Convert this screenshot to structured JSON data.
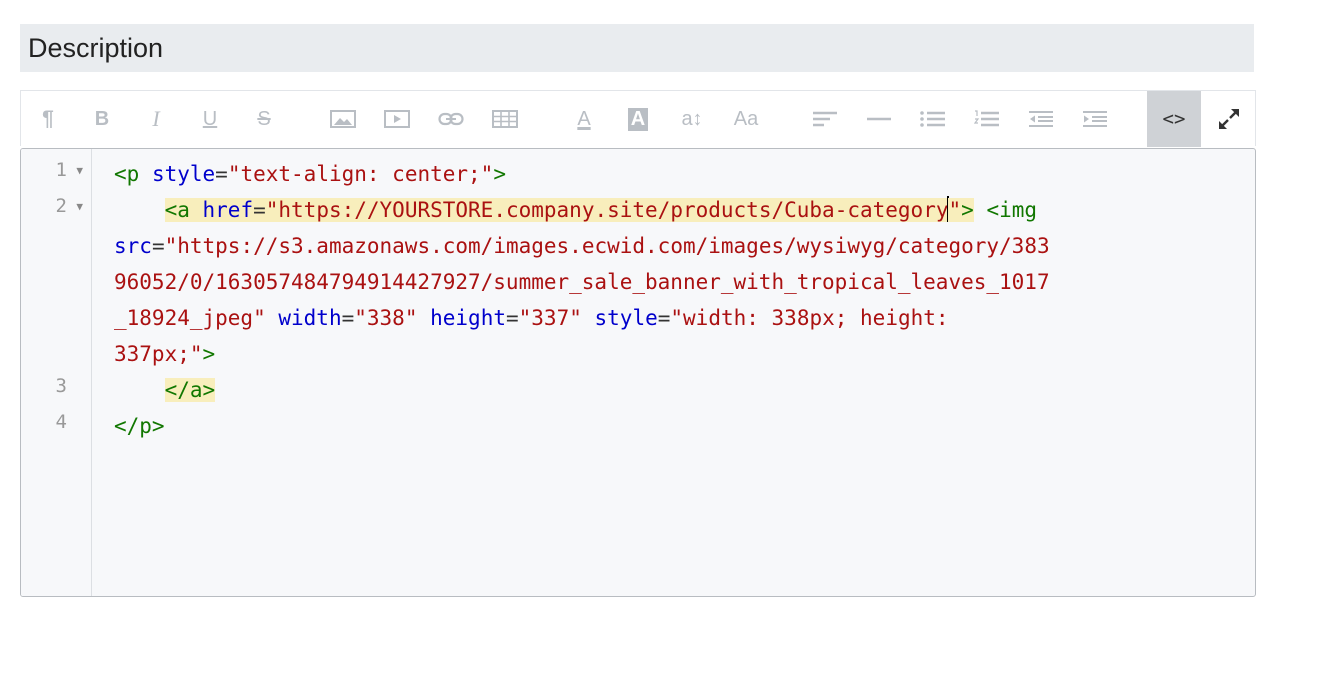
{
  "section": {
    "title": "Description"
  },
  "toolbar": {
    "paragraph": "¶",
    "bold": "B",
    "italic": "I",
    "underline": "U",
    "strike": "S",
    "font_color": "A",
    "bg_color": "A",
    "font_size": "a↕",
    "font_family": "Aa",
    "code_view": "<>"
  },
  "code": {
    "line_numbers": [
      "1",
      "2",
      "3",
      "4"
    ],
    "fold_marker": "▼",
    "l1": {
      "open": "<p ",
      "attr1": "style",
      "eq": "=",
      "val1": "\"text-align: center;\"",
      "close": ">"
    },
    "l2": {
      "open": "<a ",
      "attr1": "href",
      "eq": "=",
      "val1a": "\"https://YOURSTORE.company.site/products/Cuba-category",
      "val1b": "\"",
      "close": ">",
      "img_open": " <img",
      "w1_attr": "src",
      "w1_eq": "=",
      "w1_val": "\"https://s3.amazonaws.com/images.ecwid.com/images/wysiwyg/category/383",
      "w2_val": "96052/0/16305748479491442 7927/summer_sale_banner_with_tropical_leaves_1017",
      "w3_val": "_18924_jpeg\"",
      "w3_attr1": "width",
      "w3_val1": "\"338\"",
      "w3_attr2": "height",
      "w3_val2": "\"337\"",
      "w3_attr3": "style",
      "w3_val3": "\"width: 338px; height:",
      "w4_val": "337px;\"",
      "w4_close": ">"
    },
    "l3": {
      "close_a": "</a>"
    },
    "l4": {
      "close_p": "</p>"
    }
  }
}
